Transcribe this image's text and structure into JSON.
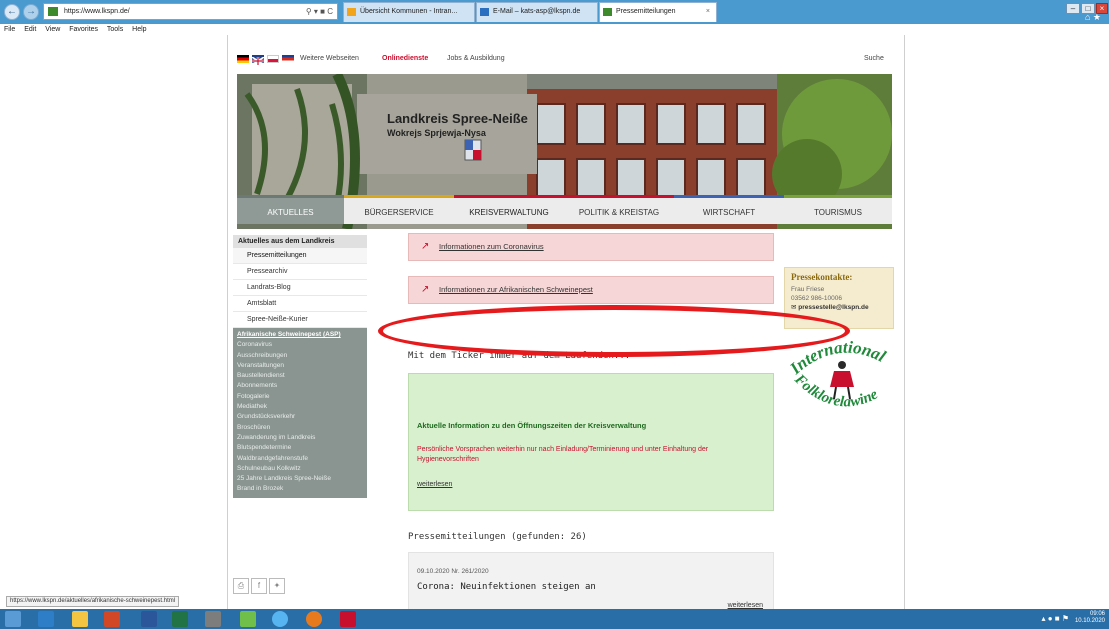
{
  "browser": {
    "url": "https://www.lkspn.de/",
    "tabs": [
      {
        "label": "Übersicht Kommunen - Intran...",
        "color": "#f2a51a"
      },
      {
        "label": "E-Mail – kats-asp@lkspn.de",
        "color": "#2b6fc0"
      },
      {
        "label": "Pressemitteilungen",
        "color": "#3d8a2c"
      }
    ],
    "menu": [
      "File",
      "Edit",
      "View",
      "Favorites",
      "Tools",
      "Help"
    ],
    "status_url": "https://www.lkspn.de/aktuelles/afrikanische-schweinepest.html"
  },
  "topbar": {
    "links": [
      "Weitere Webseiten",
      "Onlinedienste",
      "Jobs & Ausbildung"
    ],
    "search": "Suche"
  },
  "hero": {
    "title_line1": "Landkreis Spree-Neiße",
    "title_line2": "Wokrejs Sprjewja-Nysa"
  },
  "nav": [
    "AKTUELLES",
    "BÜRGERSERVICE",
    "KREISVERWALTUNG",
    "POLITIK & KREISTAG",
    "WIRTSCHAFT",
    "TOURISMUS"
  ],
  "sidebar": {
    "title": "Aktuelles aus dem Landkreis",
    "items": [
      "Pressemitteilungen",
      "Pressearchiv",
      "Landrats-Blog",
      "Amtsblatt",
      "Spree-Neiße-Kurier"
    ],
    "grey_items": [
      "Afrikanische Schweinepest (ASP)",
      "Coronavirus",
      "Ausschreibungen",
      "Veranstaltungen",
      "Baustellendienst",
      "Abonnements",
      "Fotogalerie",
      "Mediathek",
      "Grundstücksverkehr",
      "Broschüren",
      "Zuwanderung im Landkreis",
      "Blutspendetermine",
      "Waldbrandgefahrenstufe",
      "Schulneubau Kolkwitz",
      "25 Jahre Landkreis Spree-Neiße",
      "Brand in Brozek"
    ]
  },
  "main": {
    "corona_link": "Informationen zum Coronavirus",
    "asp_link": "Informationen zur Afrikanischen Schweinepest",
    "ticker": "Mit dem Ticker immer auf dem Laufenden...",
    "notice_title": "Aktuelle Information zu den Öffnungszeiten der Kreisverwaltung",
    "notice_text": "Persönliche Vorsprachen weiterhin nur nach Einladung/Terminierung und unter Einhaltung der Hygienevorschriften",
    "notice_more": "weiterlesen",
    "press_heading": "Pressemitteilungen (gefunden: 26)",
    "news": {
      "meta": "09.10.2020   Nr. 261/2020",
      "title": "Corona: Neuinfektionen steigen an",
      "more": "weiterlesen"
    }
  },
  "contacts": {
    "title": "Pressekontakte:",
    "name": "Frau Friese",
    "phone": "03562 986-10006",
    "email": "pressestelle@lkspn.de"
  },
  "logo": {
    "line1": "International",
    "line2": "Folklorelawine"
  },
  "tray": {
    "time": "09:06",
    "date": "10.10.2020"
  }
}
